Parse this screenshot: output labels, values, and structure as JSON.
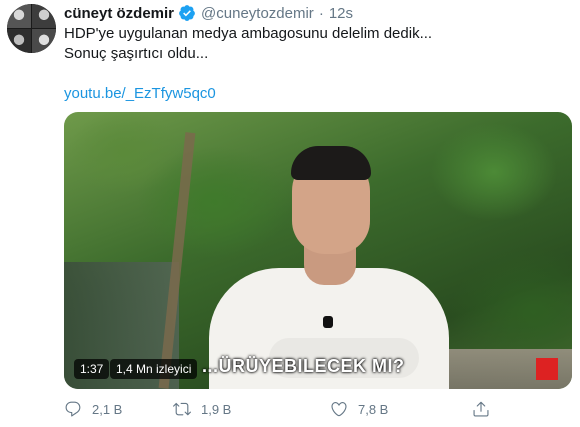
{
  "tweet": {
    "author_name": "cüneyt özdemir",
    "handle": "@cuneytozdemir",
    "separator": "·",
    "time": "12s",
    "text": "HDP'ye uygulanan medya ambagosunu delelim dedik...\nSonuç şaşırtıcı oldu...",
    "link": "youtu.be/_EzTfyw5qc0",
    "verified": true
  },
  "video": {
    "caption": "...ÜRÜYEBILECEK MI?",
    "duration": "1:37",
    "views": "1,4 Mn izleyici"
  },
  "actions": {
    "replies": "2,1 B",
    "retweets": "1,9 B",
    "likes": "7,8 B"
  },
  "colors": {
    "accent": "#1b95e0",
    "muted": "#657786",
    "text": "#14171a"
  },
  "icons": [
    "reply-icon",
    "retweet-icon",
    "like-icon",
    "share-icon",
    "verified-badge-icon"
  ]
}
